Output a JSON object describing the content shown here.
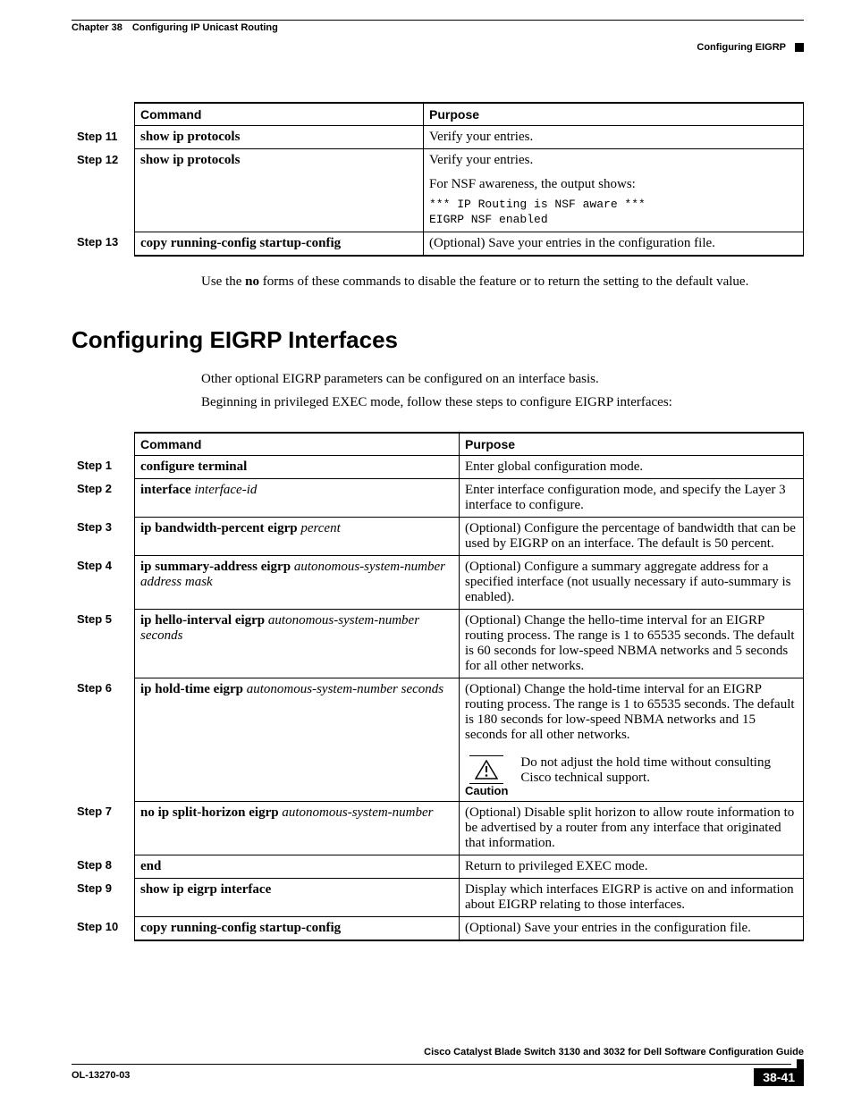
{
  "header": {
    "chapter_num": "Chapter 38",
    "chapter_title": "Configuring IP Unicast Routing",
    "section_label": "Configuring EIGRP"
  },
  "table1": {
    "headers": {
      "command": "Command",
      "purpose": "Purpose"
    },
    "rows": [
      {
        "step": "Step 11",
        "cmd_bold": "show ip protocols",
        "purpose": "Verify your entries."
      },
      {
        "step": "Step 12",
        "cmd_bold": "show ip protocols",
        "purpose": "Verify your entries.",
        "purpose2": "For NSF awareness, the output shows:",
        "mono1": "*** IP Routing is NSF aware ***",
        "mono2": "EIGRP NSF enabled"
      },
      {
        "step": "Step 13",
        "cmd_bold": "copy running-config startup-config",
        "purpose": "(Optional) Save your entries in the configuration file."
      }
    ]
  },
  "para1_pre": "Use the ",
  "para1_bold": "no",
  "para1_post": " forms of these commands to disable the feature or to return the setting to the default value.",
  "section_heading": "Configuring EIGRP Interfaces",
  "para2": "Other optional EIGRP parameters can be configured on an interface basis.",
  "para3": "Beginning in privileged EXEC mode, follow these steps to configure EIGRP interfaces:",
  "table2": {
    "headers": {
      "command": "Command",
      "purpose": "Purpose"
    },
    "rows": [
      {
        "step": "Step 1",
        "cmd_bold": "configure terminal",
        "purpose": "Enter global configuration mode."
      },
      {
        "step": "Step 2",
        "cmd_bold": "interface ",
        "cmd_italic": "interface-id",
        "purpose": "Enter interface configuration mode, and specify the Layer 3 interface to configure."
      },
      {
        "step": "Step 3",
        "cmd_bold": "ip bandwidth-percent eigrp ",
        "cmd_italic": "percent",
        "purpose": "(Optional) Configure the percentage of bandwidth that can be used by EIGRP on an interface. The default is 50 percent."
      },
      {
        "step": "Step 4",
        "cmd_bold": "ip summary-address eigrp ",
        "cmd_italic": "autonomous-system-number address mask",
        "purpose": "(Optional) Configure a summary aggregate address for a specified interface (not usually necessary if auto-summary is enabled)."
      },
      {
        "step": "Step 5",
        "cmd_bold": "ip hello-interval eigrp ",
        "cmd_italic": "autonomous-system-number seconds",
        "purpose": "(Optional) Change the hello-time interval for an EIGRP routing process. The range is 1 to 65535 seconds. The default is 60 seconds for low-speed NBMA networks and 5 seconds for all other networks."
      },
      {
        "step": "Step 6",
        "cmd_bold": "ip hold-time eigrp ",
        "cmd_italic": "autonomous-system-number seconds",
        "purpose": "(Optional) Change the hold-time interval for an EIGRP routing process. The range is 1 to 65535 seconds. The default is 180 seconds for low-speed NBMA networks and 15 seconds for all other networks.",
        "caution_label": "Caution",
        "caution_text": "Do not adjust the hold time without consulting Cisco technical support."
      },
      {
        "step": "Step 7",
        "cmd_bold": "no ip split-horizon eigrp ",
        "cmd_italic": "autonomous-system-number",
        "purpose": "(Optional) Disable split horizon to allow route information to be advertised by a router from any interface that originated that information."
      },
      {
        "step": "Step 8",
        "cmd_bold": "end",
        "purpose": "Return to privileged EXEC mode."
      },
      {
        "step": "Step 9",
        "cmd_bold": "show ip eigrp interface",
        "purpose": "Display which interfaces EIGRP is active on and information about EIGRP relating to those interfaces."
      },
      {
        "step": "Step 10",
        "cmd_bold": "copy running-config startup-config",
        "purpose": "(Optional) Save your entries in the configuration file."
      }
    ]
  },
  "footer": {
    "book_title": "Cisco Catalyst Blade Switch 3130 and 3032 for Dell Software Configuration Guide",
    "doc_number": "OL-13270-03",
    "page_number": "38-41"
  }
}
